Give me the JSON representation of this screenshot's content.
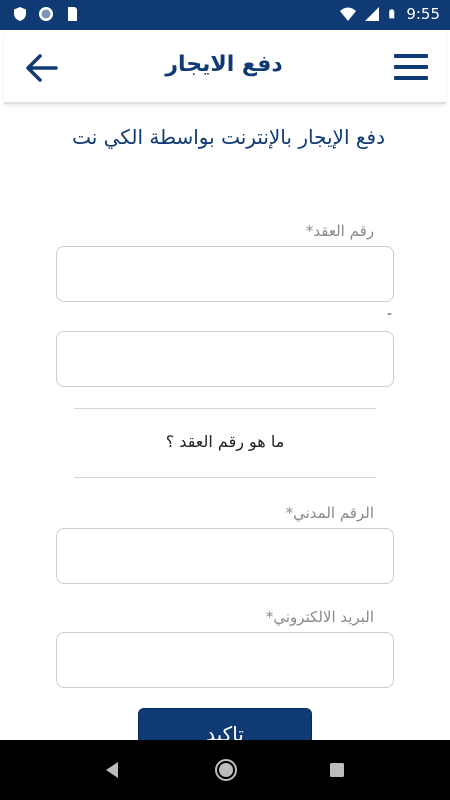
{
  "status_bar": {
    "time": "9:55",
    "icons": [
      "shield-icon",
      "circle-icon",
      "sd-card-icon",
      "wifi-icon",
      "signal-icon",
      "battery-icon"
    ]
  },
  "app_bar": {
    "title": "دفع الايجار",
    "back_icon": "arrow-left-icon",
    "menu_icon": "hamburger-menu-icon"
  },
  "main": {
    "heading": "دفع الإيجار بالإنترنت بواسطة الكي نت",
    "contract_label": "رقم العقد*",
    "contract_value": "",
    "second_dash": "-",
    "second_value": "",
    "help_link": "ما هو رقم العقد ؟",
    "civil_id_label": "الرقم المدني*",
    "civil_id_value": "",
    "email_label": "البريد الالكتروني*",
    "email_value": "",
    "submit_label": "تاكيد"
  },
  "nav_bar": {
    "icons": [
      "nav-back-icon",
      "nav-home-icon",
      "nav-recents-icon"
    ]
  },
  "colors": {
    "primary": "#0f3a73",
    "label_gray": "#8a8a8a",
    "input_border": "#c8d0d6"
  }
}
